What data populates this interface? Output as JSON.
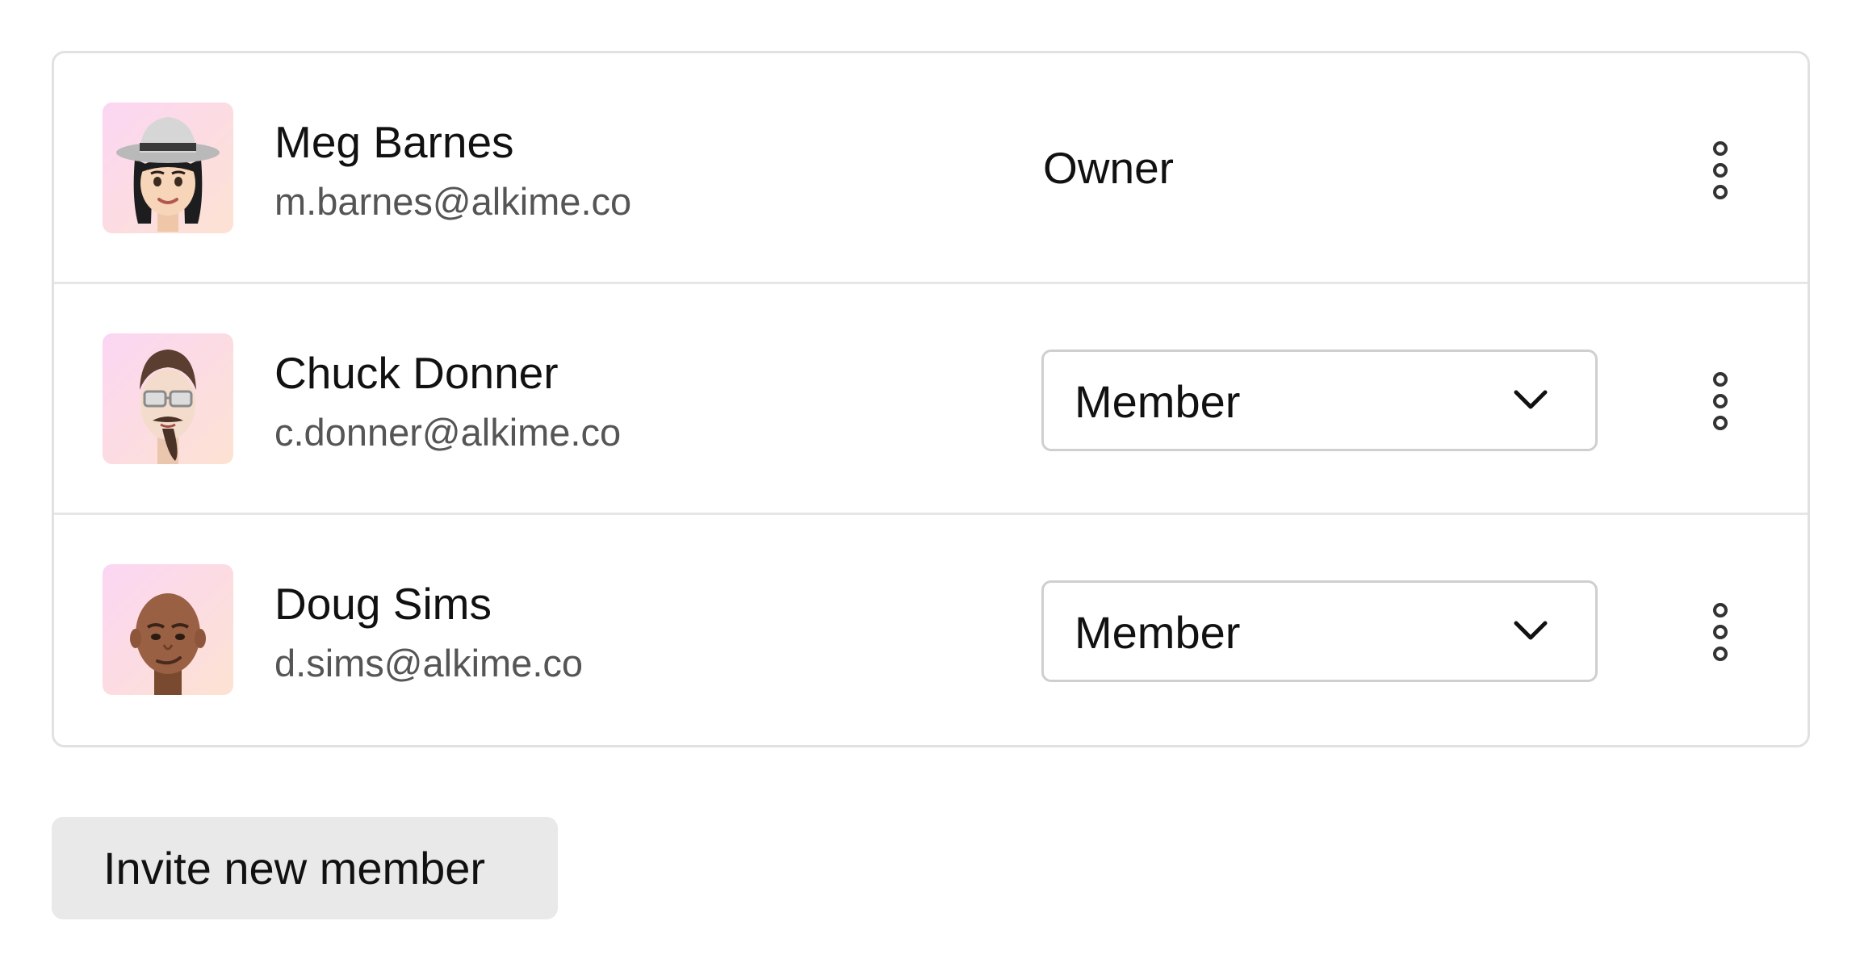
{
  "members": [
    {
      "name": "Meg Barnes",
      "email": "m.barnes@alkime.co",
      "role": "Owner",
      "role_editable": false,
      "avatar_icon": "memoji-woman-hat-icon"
    },
    {
      "name": "Chuck Donner",
      "email": "c.donner@alkime.co",
      "role": "Member",
      "role_editable": true,
      "avatar_icon": "memoji-man-glasses-icon"
    },
    {
      "name": "Doug Sims",
      "email": "d.sims@alkime.co",
      "role": "Member",
      "role_editable": true,
      "avatar_icon": "memoji-man-bald-icon"
    }
  ],
  "actions": {
    "invite_label": "Invite new member"
  },
  "colors": {
    "avatar_gradient_start": "#fbd6f3",
    "avatar_gradient_end": "#fde2d2",
    "card_border": "#e1e1e1",
    "invite_button_bg": "#e9e9e9",
    "email_text": "#555555"
  }
}
